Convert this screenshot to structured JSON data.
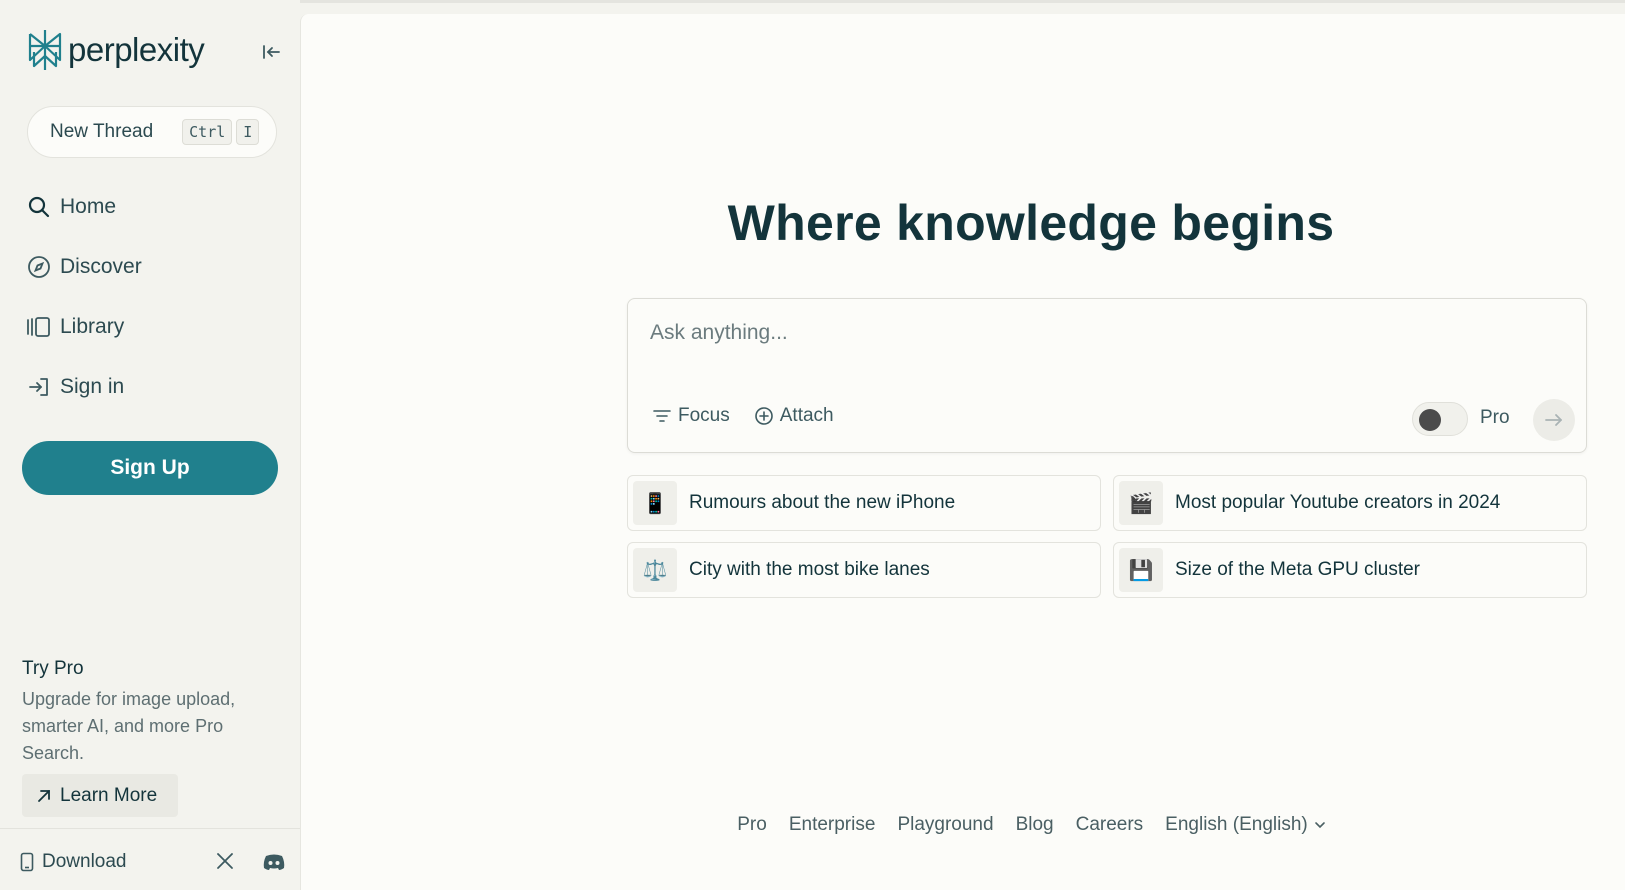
{
  "sidebar": {
    "logo_text": "perplexity",
    "new_thread": {
      "label": "New Thread",
      "kbd1": "Ctrl",
      "kbd2": "I"
    },
    "nav": [
      {
        "label": "Home",
        "icon": "search-icon"
      },
      {
        "label": "Discover",
        "icon": "compass-icon"
      },
      {
        "label": "Library",
        "icon": "library-icon"
      },
      {
        "label": "Sign in",
        "icon": "sign-in-icon"
      }
    ],
    "signup_label": "Sign Up",
    "try_pro": {
      "title": "Try Pro",
      "description": "Upgrade for image upload, smarter AI, and more Pro Search.",
      "learn_more": "Learn More"
    },
    "download_label": "Download"
  },
  "main": {
    "headline": "Where knowledge begins",
    "ask": {
      "placeholder": "Ask anything...",
      "focus_label": "Focus",
      "attach_label": "Attach",
      "pro_label": "Pro"
    },
    "suggestions": [
      {
        "emoji": "📱",
        "text": "Rumours about the new iPhone"
      },
      {
        "emoji": "🎬",
        "text": "Most popular Youtube creators in 2024"
      },
      {
        "emoji": "⚖️",
        "text": "City with the most bike lanes"
      },
      {
        "emoji": "💾",
        "text": "Size of the Meta GPU cluster"
      }
    ],
    "footer_links": [
      "Pro",
      "Enterprise",
      "Playground",
      "Blog",
      "Careers"
    ],
    "language": "English (English)"
  },
  "colors": {
    "accent": "#20808d",
    "background": "#f3f3ee",
    "panel": "#fcfcf9",
    "text": "#13343b"
  }
}
